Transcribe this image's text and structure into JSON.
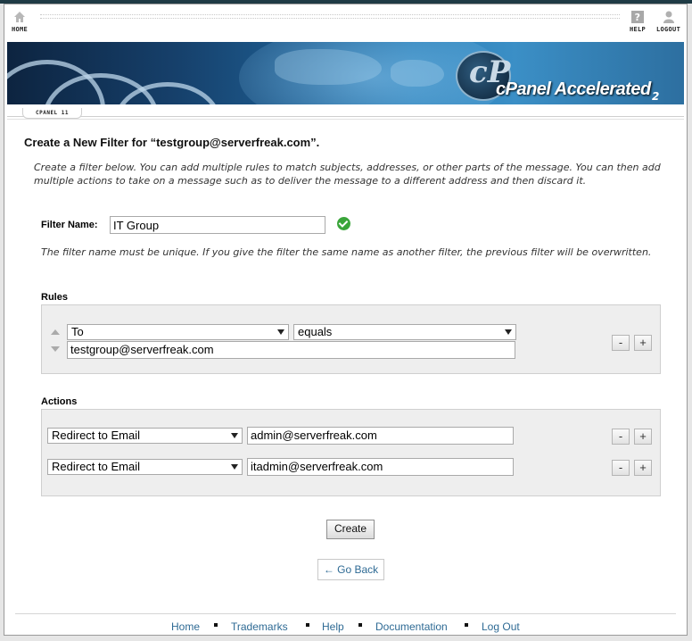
{
  "nav": {
    "home_label": "HOME",
    "help_label": "HELP",
    "logout_label": "LOGOUT"
  },
  "banner": {
    "logo_text": "cPanel Accelerated",
    "logo_sub": "2"
  },
  "tab": {
    "label": "CPANEL 11"
  },
  "page": {
    "title": "Create a New Filter for “testgroup@serverfreak.com”.",
    "intro": "Create a filter below. You can add multiple rules to match subjects, addresses, or other parts of the message. You can then add multiple actions to take on a message such as to deliver the message to a different address and then discard it."
  },
  "filter_name": {
    "label": "Filter Name:",
    "value": "IT Group",
    "note": "The filter name must be unique. If you give the filter the same name as another filter, the previous filter will be overwritten."
  },
  "rules": {
    "heading": "Rules",
    "items": [
      {
        "part": "To",
        "match": "equals",
        "value": "testgroup@serverfreak.com",
        "remove_label": "-",
        "add_label": "+"
      }
    ]
  },
  "actions": {
    "heading": "Actions",
    "items": [
      {
        "action": "Redirect to Email",
        "value": "admin@serverfreak.com",
        "remove_label": "-",
        "add_label": "+"
      },
      {
        "action": "Redirect to Email",
        "value": "itadmin@serverfreak.com",
        "remove_label": "-",
        "add_label": "+"
      }
    ]
  },
  "buttons": {
    "create_label": "Create",
    "go_back_label": "← Go Back"
  },
  "footer": {
    "links": [
      "Home",
      "Trademarks",
      "Help",
      "Documentation",
      "Log Out"
    ]
  },
  "colors": {
    "link": "#2e6a94",
    "valid_check": "#3aa53a",
    "panel_bg": "#eeeeee"
  }
}
